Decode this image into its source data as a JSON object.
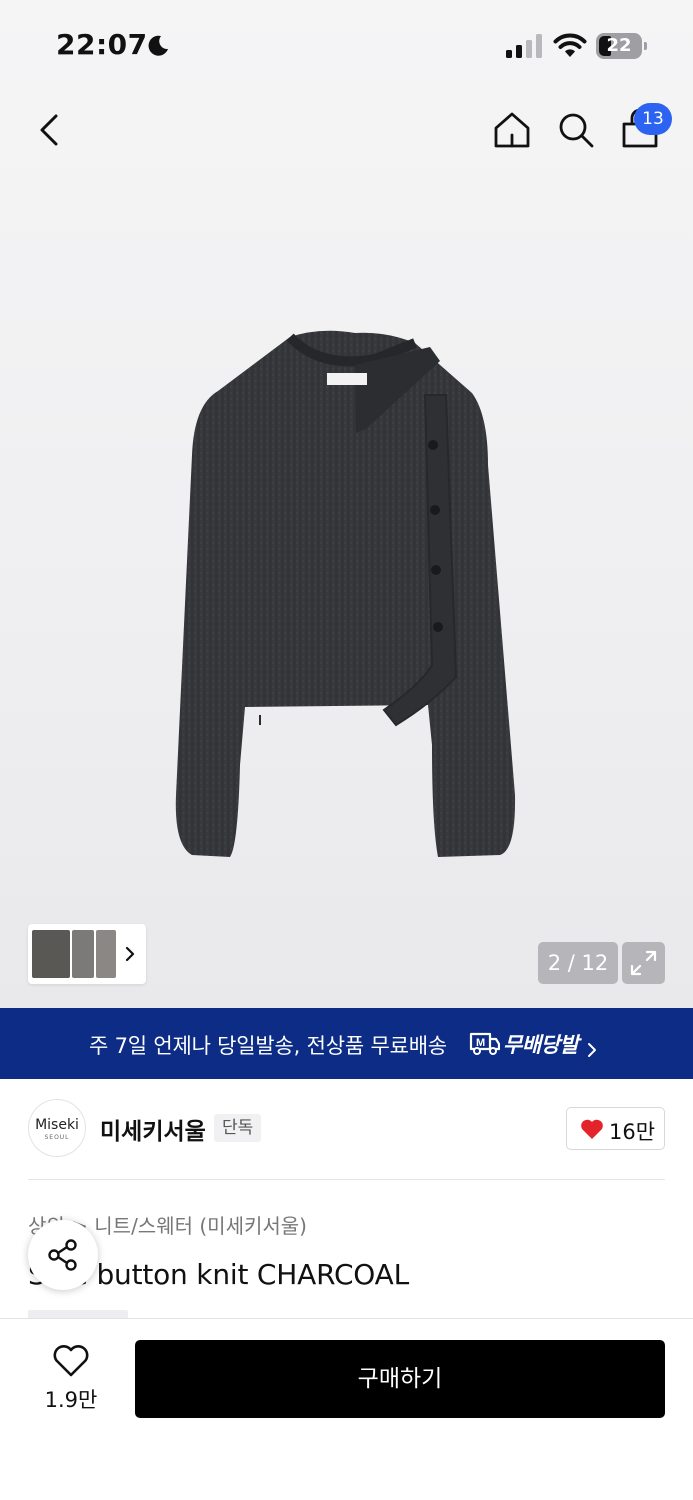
{
  "status_bar": {
    "time": "22:07",
    "battery_level": "22"
  },
  "header": {
    "cart_count": "13"
  },
  "gallery": {
    "page_indicator": "2 / 12"
  },
  "shipping_banner": {
    "text": "주 7일 언제나 당일발송, 전상품 무료배송",
    "brand_label": "무배당발"
  },
  "brand": {
    "logo_text": "Miseki",
    "logo_subtext": "SEOUL",
    "name": "미세키서울",
    "badge": "단독",
    "likes": "16만"
  },
  "product": {
    "category_path": "상의 > 니트/스웨터 (미세키서울)",
    "title": "Side button knit CHARCOAL"
  },
  "bottom_bar": {
    "wish_count": "1.9만",
    "buy_label": "구매하기"
  },
  "colors": {
    "banner_bg": "#0c2c86",
    "badge_blue": "#2c63f0",
    "heart_red": "#e3242b",
    "buy_button": "#000000"
  }
}
